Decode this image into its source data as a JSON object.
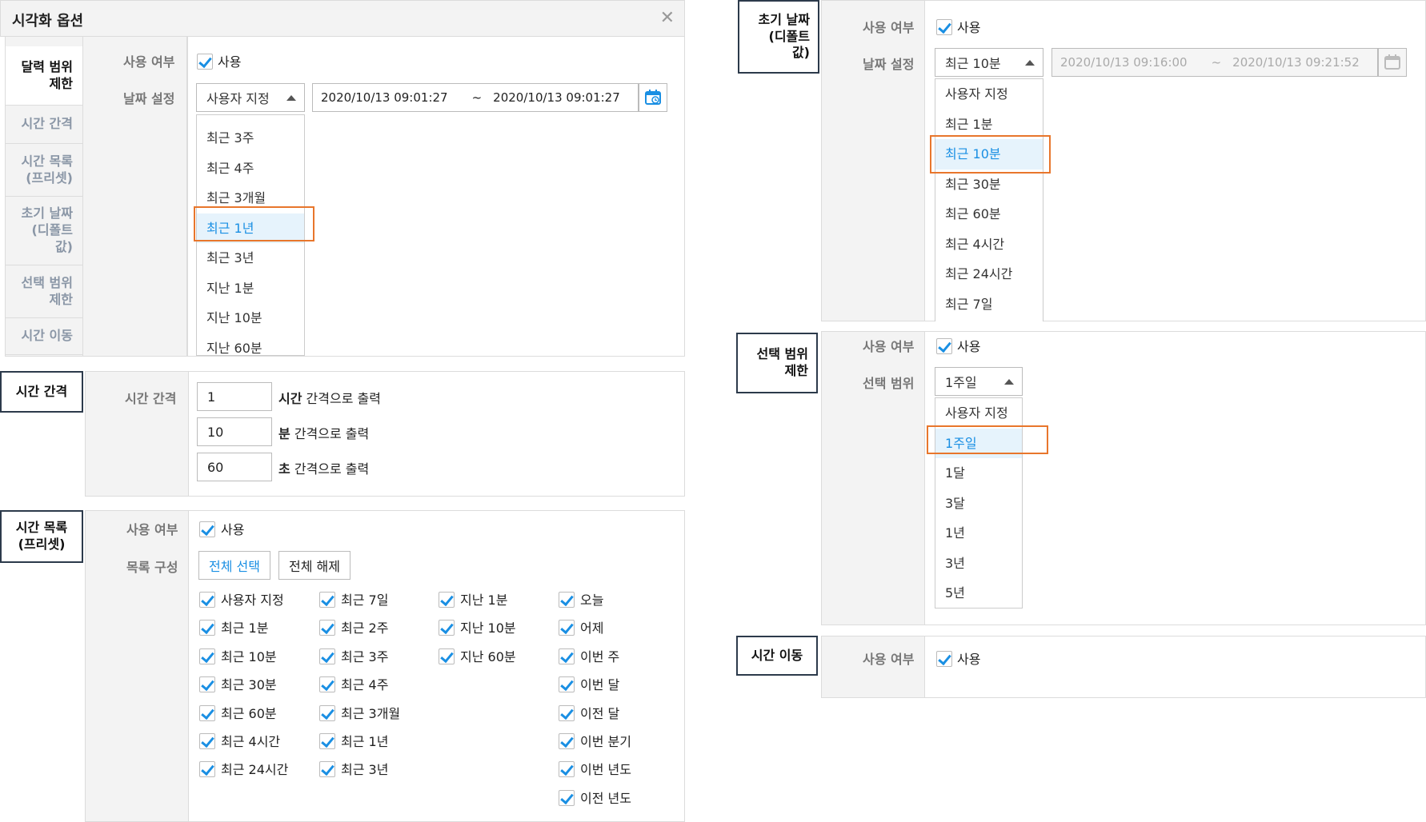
{
  "dialog": {
    "title": "시각화 옵션",
    "close": "✕",
    "nav": [
      {
        "label": "달력 범위\n제한",
        "active": true
      },
      {
        "label": "시간 간격",
        "active": false
      },
      {
        "label": "시간 목록\n(프리셋)",
        "active": false
      },
      {
        "label": "초기 날짜\n(디폴트\n값)",
        "active": false
      },
      {
        "label": "선택 범위\n제한",
        "active": false
      },
      {
        "label": "시간 이동",
        "active": false
      }
    ],
    "use_label": "사용 여부",
    "use_text": "사용",
    "date_label": "날짜 설정",
    "date_select": "사용자 지정",
    "date_from": "2020/10/13 09:01:27",
    "tilde": "~",
    "date_to": "2020/10/13 09:01:27",
    "dropdown": [
      "최근 3주",
      "최근 4주",
      "최근 3개월",
      "최근 1년",
      "최근 3년",
      "지난 1분",
      "지난 10분",
      "지난 60분"
    ],
    "dropdown_active": 3
  },
  "interval": {
    "tab": "시간 간격",
    "label": "시간 간격",
    "rows": [
      {
        "value": "1",
        "unit": "시간",
        "suffix": " 간격으로 출력"
      },
      {
        "value": "10",
        "unit": "분",
        "suffix": " 간격으로 출력"
      },
      {
        "value": "60",
        "unit": "초",
        "suffix": " 간격으로 출력"
      }
    ]
  },
  "presets": {
    "tab": "시간 목록\n(프리셋)",
    "use_label": "사용 여부",
    "use_text": "사용",
    "list_label": "목록 구성",
    "select_all": "전체 선택",
    "deselect_all": "전체 해제",
    "columns": [
      [
        "사용자 지정",
        "최근 1분",
        "최근 10분",
        "최근 30분",
        "최근 60분",
        "최근 4시간",
        "최근 24시간"
      ],
      [
        "최근 7일",
        "최근 2주",
        "최근 3주",
        "최근 4주",
        "최근 3개월",
        "최근 1년",
        "최근 3년"
      ],
      [
        "지난 1분",
        "지난 10분",
        "지난 60분"
      ],
      [
        "오늘",
        "어제",
        "이번 주",
        "이번 달",
        "이전 달",
        "이번 분기",
        "이번 년도",
        "이전 년도"
      ]
    ]
  },
  "initial": {
    "tab": "초기 날짜\n(디폴트\n값)",
    "use_label": "사용 여부",
    "use_text": "사용",
    "date_label": "날짜 설정",
    "select": "최근 10분",
    "date_from": "2020/10/13 09:16:00",
    "tilde": "~",
    "date_to": "2020/10/13 09:21:52",
    "dropdown": [
      "사용자 지정",
      "최근 1분",
      "최근 10분",
      "최근 30분",
      "최근 60분",
      "최근 4시간",
      "최근 24시간",
      "최근 7일"
    ],
    "dropdown_active": 2
  },
  "range": {
    "tab": "선택 범위\n제한",
    "use_label": "사용 여부",
    "use_text": "사용",
    "range_label": "선택 범위",
    "select": "1주일",
    "dropdown": [
      "사용자 지정",
      "1주일",
      "1달",
      "3달",
      "1년",
      "3년",
      "5년"
    ],
    "dropdown_active": 1
  },
  "move": {
    "tab": "시간 이동",
    "use_label": "사용 여부",
    "use_text": "사용"
  },
  "colors": {
    "accent": "#1a8fe3",
    "highlight": "#e8762c",
    "tab_border": "#2c3a4b"
  }
}
